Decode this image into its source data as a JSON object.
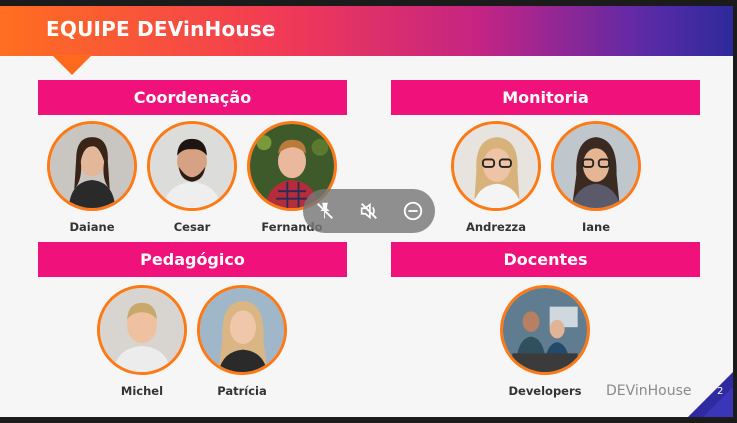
{
  "header": {
    "title": "EQUIPE DEVinHouse"
  },
  "sections": {
    "coordenacao": {
      "label": "Coordenação",
      "people": [
        "Daiane",
        "Cesar",
        "Fernando"
      ]
    },
    "monitoria": {
      "label": "Monitoria",
      "people": [
        "Andrezza",
        "Iane"
      ]
    },
    "pedagogico": {
      "label": "Pedagógico",
      "people": [
        "Michel",
        "Patrícia"
      ]
    },
    "docentes": {
      "label": "Docentes",
      "people": [
        "Developers"
      ]
    }
  },
  "overlay": {
    "icons": [
      "mic-off-icon",
      "audio-off-icon",
      "minus-circle-icon"
    ]
  },
  "footer": {
    "brand": "DEVinHouse",
    "page": "2"
  },
  "colors": {
    "section": "#f0117a",
    "avatar_ring": "#ff7a16",
    "corner": "#2f2aa0"
  }
}
